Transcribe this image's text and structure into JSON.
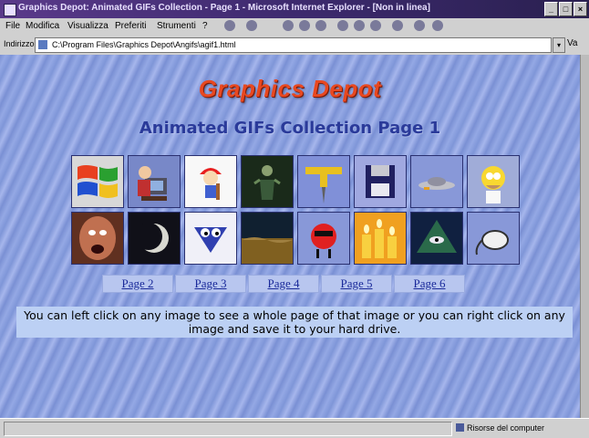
{
  "window": {
    "title": "Graphics Depot: Animated GIFs Collection - Page 1 - Microsoft Internet Explorer - [Non in linea]"
  },
  "menu": {
    "items": [
      "File",
      "Modifica",
      "Visualizza",
      "Preferiti",
      "Strumenti",
      "?"
    ]
  },
  "address": {
    "label": "Indirizzo",
    "url": "C:\\Program Files\\Graphics Depot\\Angifs\\agif1.html",
    "go_label": "Va"
  },
  "page": {
    "logo": "Graphics Depot",
    "subtitle": "Animated GIFs Collection Page 1",
    "gif_icons": [
      "windows-logo-icon",
      "computer-user-icon",
      "construction-worker-icon",
      "dark-figure-icon",
      "pushpin-icon",
      "floppy-disk-icon",
      "spaceship-icon",
      "homer-simpson-icon",
      "screaming-face-icon",
      "moon-phase-icon",
      "smiley-checkmark-icon",
      "planet-surface-icon",
      "walking-tomato-icon",
      "candles-icon",
      "pyramid-eye-icon",
      "mouse-icon"
    ],
    "page_links": [
      "Page 2",
      "Page 3",
      "Page 4",
      "Page 5",
      "Page 6"
    ],
    "instructions": "You can left click on any image to see a whole page of that image or you can right click on any image and save it to your hard drive."
  },
  "status": {
    "zone": "Risorse del computer"
  },
  "colors": {
    "logo": "#e84820",
    "subtitle": "#2a3a9a",
    "link": "#1a2a9a",
    "background": "#8aa0dc"
  }
}
